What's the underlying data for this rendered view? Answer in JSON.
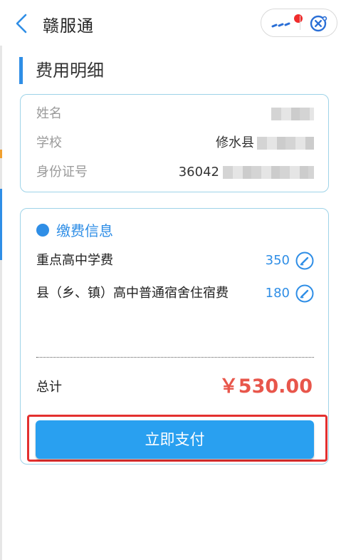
{
  "header": {
    "title": "赣服通",
    "back_icon": "chevron-left-icon",
    "more_icon": "more-dots-icon",
    "close_icon": "close-circle-icon",
    "notification_dot_color": "#f02c2c"
  },
  "section": {
    "title": "费用明细"
  },
  "student_info": {
    "rows": [
      {
        "label": "姓名",
        "value": ""
      },
      {
        "label": "学校",
        "value": "修水县"
      },
      {
        "label": "身份证号",
        "value": "36042"
      }
    ]
  },
  "fee_info": {
    "title": "缴费信息",
    "items": [
      {
        "name": "重点高中学费",
        "amount": "350"
      },
      {
        "name": "县（乡、镇）高中普通宿舍住宿费",
        "amount": "180"
      }
    ],
    "total_label": "总计",
    "total_value": "￥530.00"
  },
  "actions": {
    "pay_label": "立即支付"
  },
  "colors": {
    "accent": "#2f8ee6",
    "button": "#29a0f0",
    "total": "#e8564b",
    "highlight": "#e3302f"
  }
}
